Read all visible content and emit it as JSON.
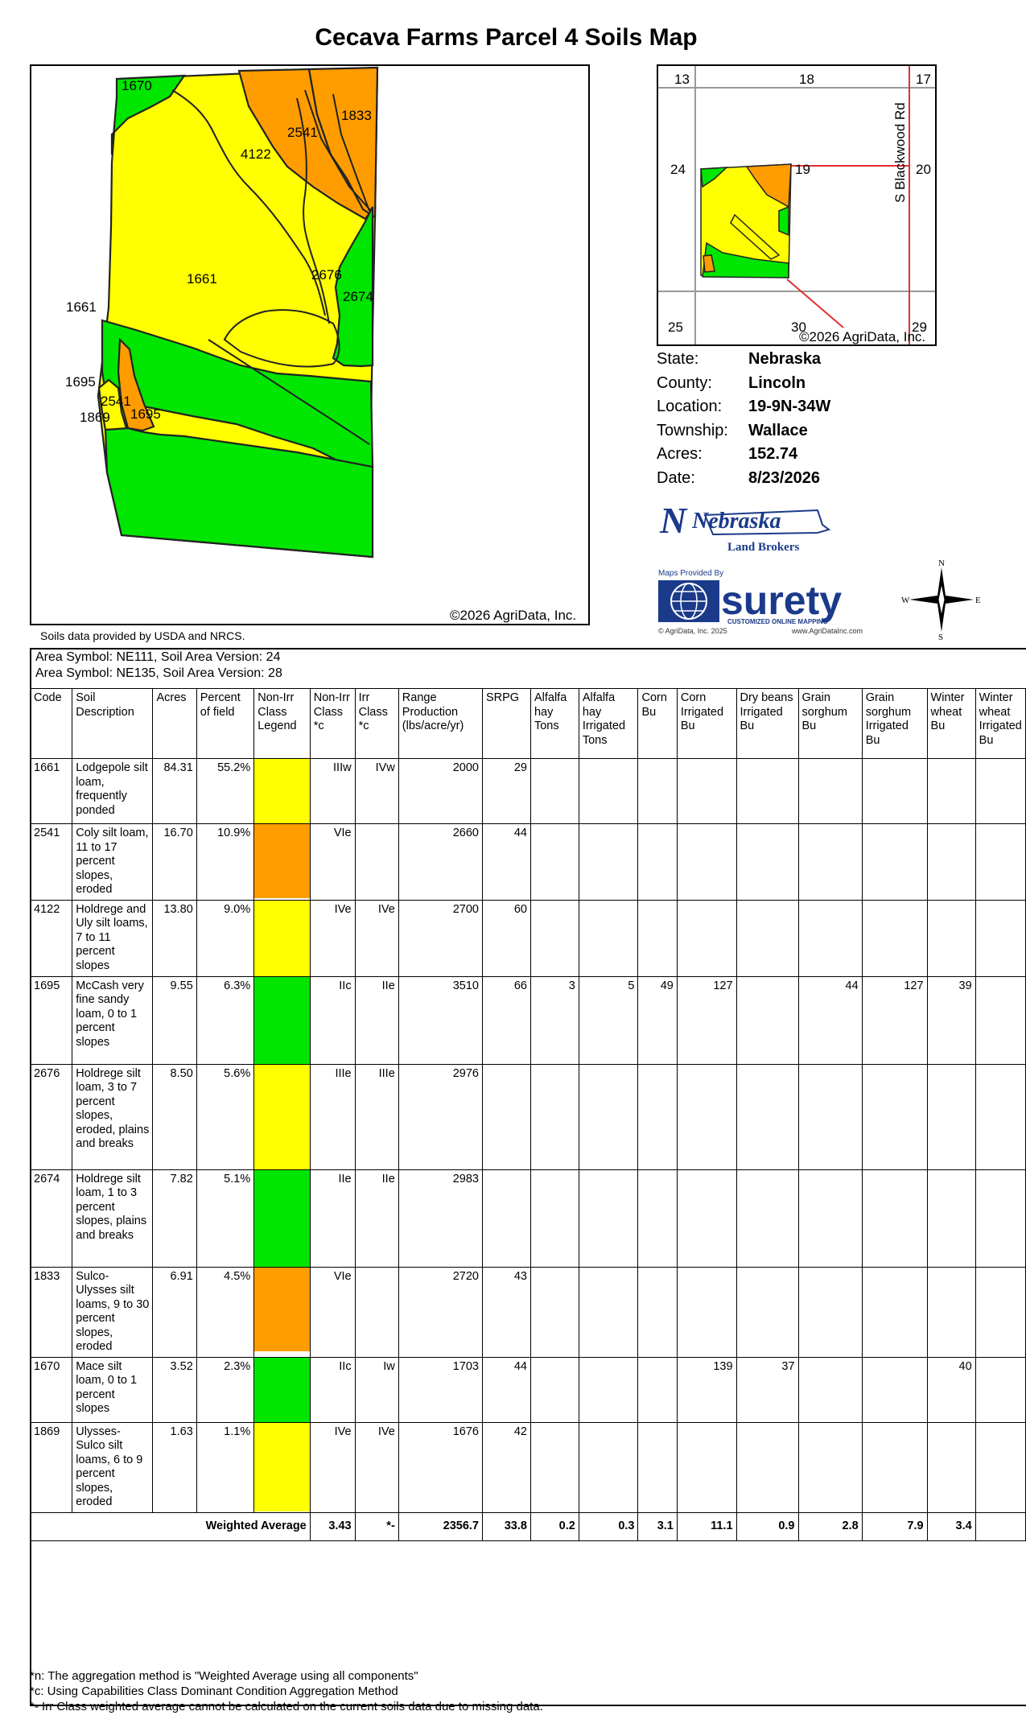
{
  "title": "Cecava Farms Parcel 4 Soils Map",
  "main_map": {
    "labels": [
      "1670",
      "1833",
      "2541",
      "4122",
      "1661",
      "2676",
      "2674",
      "1661",
      "1695",
      "2541",
      "1869",
      "1695"
    ],
    "copyright": "©2026 AgriData, Inc."
  },
  "inset_map": {
    "sections": [
      "13",
      "18",
      "17",
      "24",
      "19",
      "20",
      "25",
      "30",
      "29"
    ],
    "road": "S Blackwood Rd",
    "copyright": "©2026 AgriData, Inc."
  },
  "info": [
    {
      "label": "State:",
      "value": "Nebraska"
    },
    {
      "label": "County:",
      "value": "Lincoln"
    },
    {
      "label": "Location:",
      "value": "19-9N-34W"
    },
    {
      "label": "Township:",
      "value": "Wallace"
    },
    {
      "label": "Acres:",
      "value": "152.74"
    },
    {
      "label": "Date:",
      "value": "8/23/2026"
    }
  ],
  "logos": {
    "nlb_big": "Nebraska",
    "nlb_small": "Land Brokers",
    "surety_top": "Maps Provided By",
    "surety_name": "surety",
    "surety_tag": "CUSTOMIZED ONLINE MAPPING",
    "surety_copy": "© AgriData, Inc. 2025",
    "surety_url": "www.AgriDataInc.com",
    "compass": {
      "n": "N",
      "s": "S",
      "e": "E",
      "w": "W"
    }
  },
  "source_note": "Soils data provided by USDA and NRCS.",
  "area_symbols": [
    "Area Symbol: NE111, Soil Area Version: 24",
    "Area Symbol: NE135, Soil Area Version: 28"
  ],
  "colors": {
    "yellow": "#ffff00",
    "orange": "#ff9d00",
    "green": "#00e600"
  },
  "table": {
    "headers": [
      "Code",
      "Soil Description",
      "Acres",
      "Percent of field",
      "Non-Irr Class Legend",
      "Non-Irr Class *c",
      "Irr Class *c",
      "Range Production (lbs/acre/yr)",
      "SRPG",
      "Alfalfa hay Tons",
      "Alfalfa hay Irrigated Tons",
      "Corn Bu",
      "Corn Irrigated Bu",
      "Dry beans Irrigated Bu",
      "Grain sorghum Bu",
      "Grain sorghum Irrigated Bu",
      "Winter wheat Bu",
      "Winter wheat Irrigated Bu"
    ],
    "rows": [
      {
        "code": "1661",
        "desc": "Lodgepole silt loam, frequently ponded",
        "acres": "84.31",
        "pct": "55.2%",
        "legend": "yellow",
        "nonirr": "IIIw",
        "irr": "IVw",
        "range": "2000",
        "srpg": "29",
        "alf": "",
        "alfirr": "",
        "corn": "",
        "cornirr": "",
        "beans": "",
        "sorg": "",
        "sorgirr": "",
        "wheat": "",
        "wheatirr": ""
      },
      {
        "code": "2541",
        "desc": "Coly silt loam, 11 to 17 percent slopes, eroded",
        "acres": "16.70",
        "pct": "10.9%",
        "legend": "orange",
        "nonirr": "VIe",
        "irr": "",
        "range": "2660",
        "srpg": "44",
        "alf": "",
        "alfirr": "",
        "corn": "",
        "cornirr": "",
        "beans": "",
        "sorg": "",
        "sorgirr": "",
        "wheat": "",
        "wheatirr": ""
      },
      {
        "code": "4122",
        "desc": "Holdrege and Uly silt loams, 7 to 11 percent slopes",
        "acres": "13.80",
        "pct": "9.0%",
        "legend": "yellow",
        "nonirr": "IVe",
        "irr": "IVe",
        "range": "2700",
        "srpg": "60",
        "alf": "",
        "alfirr": "",
        "corn": "",
        "cornirr": "",
        "beans": "",
        "sorg": "",
        "sorgirr": "",
        "wheat": "",
        "wheatirr": ""
      },
      {
        "code": "1695",
        "desc": "McCash very fine sandy loam, 0 to 1 percent slopes",
        "acres": "9.55",
        "pct": "6.3%",
        "legend": "green",
        "nonirr": "IIc",
        "irr": "IIe",
        "range": "3510",
        "srpg": "66",
        "alf": "3",
        "alfirr": "5",
        "corn": "49",
        "cornirr": "127",
        "beans": "",
        "sorg": "44",
        "sorgirr": "127",
        "wheat": "39",
        "wheatirr": ""
      },
      {
        "code": "2676",
        "desc": "Holdrege silt loam, 3 to 7 percent slopes, eroded, plains and breaks",
        "acres": "8.50",
        "pct": "5.6%",
        "legend": "yellow",
        "nonirr": "IIIe",
        "irr": "IIIe",
        "range": "2976",
        "srpg": "",
        "alf": "",
        "alfirr": "",
        "corn": "",
        "cornirr": "",
        "beans": "",
        "sorg": "",
        "sorgirr": "",
        "wheat": "",
        "wheatirr": ""
      },
      {
        "code": "2674",
        "desc": "Holdrege silt loam, 1 to 3 percent slopes, plains and breaks",
        "acres": "7.82",
        "pct": "5.1%",
        "legend": "green",
        "nonirr": "IIe",
        "irr": "IIe",
        "range": "2983",
        "srpg": "",
        "alf": "",
        "alfirr": "",
        "corn": "",
        "cornirr": "",
        "beans": "",
        "sorg": "",
        "sorgirr": "",
        "wheat": "",
        "wheatirr": ""
      },
      {
        "code": "1833",
        "desc": "Sulco-Ulysses silt loams, 9 to 30 percent slopes, eroded",
        "acres": "6.91",
        "pct": "4.5%",
        "legend": "orange",
        "nonirr": "VIe",
        "irr": "",
        "range": "2720",
        "srpg": "43",
        "alf": "",
        "alfirr": "",
        "corn": "",
        "cornirr": "",
        "beans": "",
        "sorg": "",
        "sorgirr": "",
        "wheat": "",
        "wheatirr": ""
      },
      {
        "code": "1670",
        "desc": "Mace silt loam, 0 to 1 percent slopes",
        "acres": "3.52",
        "pct": "2.3%",
        "legend": "green",
        "nonirr": "IIc",
        "irr": "Iw",
        "range": "1703",
        "srpg": "44",
        "alf": "",
        "alfirr": "",
        "corn": "",
        "cornirr": "139",
        "beans": "37",
        "sorg": "",
        "sorgirr": "",
        "wheat": "40",
        "wheatirr": ""
      },
      {
        "code": "1869",
        "desc": "Ulysses-Sulco silt loams, 6 to 9 percent slopes, eroded",
        "acres": "1.63",
        "pct": "1.1%",
        "legend": "yellow",
        "nonirr": "IVe",
        "irr": "IVe",
        "range": "1676",
        "srpg": "42",
        "alf": "",
        "alfirr": "",
        "corn": "",
        "cornirr": "",
        "beans": "",
        "sorg": "",
        "sorgirr": "",
        "wheat": "",
        "wheatirr": ""
      }
    ],
    "weighted": {
      "label": "Weighted Average",
      "nonirr": "3.43",
      "irr": "*-",
      "range": "2356.7",
      "srpg": "33.8",
      "alf": "0.2",
      "alfirr": "0.3",
      "corn": "3.1",
      "cornirr": "11.1",
      "beans": "0.9",
      "sorg": "2.8",
      "sorgirr": "7.9",
      "wheat": "3.4",
      "wheatirr": ""
    }
  },
  "footnotes": [
    "*n: The aggregation method is \"Weighted Average using all components\"",
    "*c: Using Capabilities Class Dominant Condition Aggregation Method",
    "*- Irr Class weighted average cannot be calculated on the current soils data due to missing data."
  ]
}
